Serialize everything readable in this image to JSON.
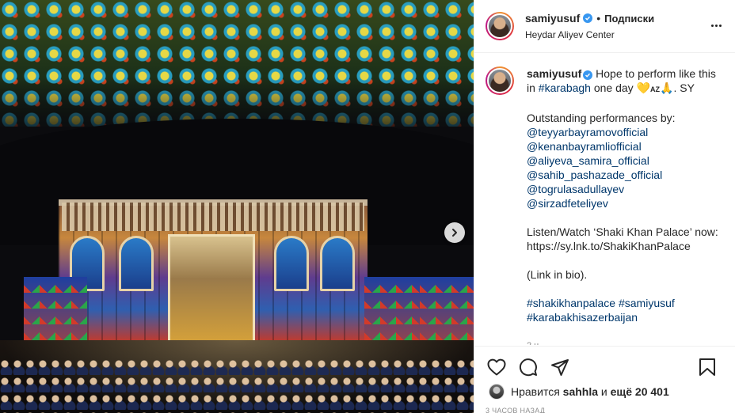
{
  "post": {
    "username": "samiyusuf",
    "follow_label": "Подписки",
    "dot": "•",
    "location": "Heydar Aliyev Center"
  },
  "caption": {
    "text_before": " Hope to perform like this in ",
    "hashtag_karabagh": "#karabagh",
    "text_after": " one day ",
    "emoji_heart": "💛",
    "flag_code": "AZ",
    "emoji_pray": "🙏",
    "sign": ". SY",
    "performances_heading": "Outstanding performances by:",
    "mentions": [
      "@teyyarbayramovofficial",
      "@kenanbayramliofficial",
      "@aliyeva_samira_official",
      "@sahib_pashazade_official",
      "@togrulasadullayev",
      "@sirzadfeteliyev"
    ],
    "listen_label": "Listen/Watch ‘Shaki Khan Palace’ now:",
    "listen_url": "https://sy.lnk.to/ShakiKhanPalace",
    "link_in_bio": "(Link in bio).",
    "hashtags": [
      "#shakikhanpalace",
      "#samiyusuf",
      "#karabakhisazerbaijan"
    ],
    "cut_line": "2 н"
  },
  "likes": {
    "prefix": "Нравится",
    "user": "sahhla",
    "middle": "и",
    "count": "ещё 20 401"
  },
  "time": "3 ЧАСОВ НАЗАД",
  "icons": {
    "like": "heart-icon",
    "comment": "comment-icon",
    "share": "share-icon",
    "save": "bookmark-icon",
    "more": "more-icon",
    "next": "chevron-right-icon",
    "verified": "verified-icon"
  },
  "colors": {
    "link": "#00376b",
    "verified": "#3897f0",
    "muted": "#8e8e8e"
  }
}
